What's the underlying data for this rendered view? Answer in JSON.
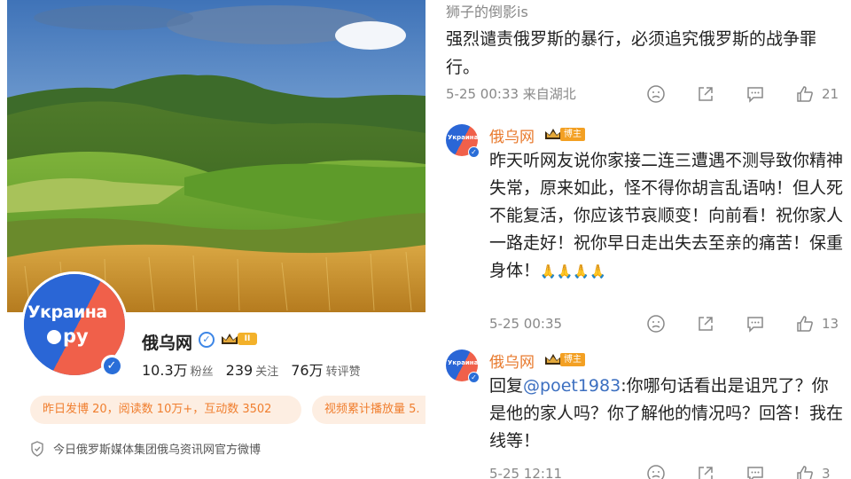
{
  "profile": {
    "avatar_text_top": "Украина",
    "avatar_text_bottom": "ру",
    "name": "俄乌网",
    "level_badge": "II",
    "stats": [
      {
        "num": "10.3万",
        "label": "粉丝"
      },
      {
        "num": "239",
        "label": "关注"
      },
      {
        "num": "76万",
        "label": "转评赞"
      }
    ],
    "pill_yesterday": "昨日发博 20，阅读数 10万+，互动数 3502",
    "pill_video": "视频累计播放量 5.",
    "bio": "今日俄罗斯媒体集团俄乌资讯网官方微博",
    "icons": {
      "verify": "verified-v-icon",
      "crown": "crown-icon",
      "shield": "shield-icon"
    }
  },
  "comments": {
    "prev": {
      "user": "狮子的倒影is",
      "text": "强烈谴责俄罗斯的暴行，必须追究俄罗斯的战争罪行。",
      "time": "5-25 00:33 来自湖北",
      "likes": "21"
    },
    "reply1": {
      "user": "俄乌网",
      "badge": "博主",
      "avatar_text": "Украина",
      "text": "昨天听网友说你家接二连三遭遇不测导致你精神失常，原来如此，怪不得你胡言乱语呐！但人死不能复活，你应该节哀顺变！向前看！祝你家人一路走好！祝你早日走出失去至亲的痛苦！保重身体！",
      "emoji": "🙏🙏🙏🙏",
      "time": "5-25 00:35",
      "likes": "13"
    },
    "reply2": {
      "user": "俄乌网",
      "badge": "博主",
      "avatar_text": "Украина",
      "prefix": "回复",
      "mention": "@poet1983",
      "text": ":你哪句话看出是诅咒了？你是他的家人吗？你了解他的情况吗？回答！我在线等！",
      "time": "5-25 12:11",
      "likes": "3"
    },
    "action_icons": [
      "dislike-icon",
      "share-icon",
      "comment-icon",
      "like-icon"
    ]
  },
  "colors": {
    "brand_orange": "#e8792c",
    "pill_bg": "#fdeee2",
    "avatar_blue": "#2a66d6",
    "avatar_red": "#f0604a",
    "mention_blue": "#3c6fc0"
  }
}
